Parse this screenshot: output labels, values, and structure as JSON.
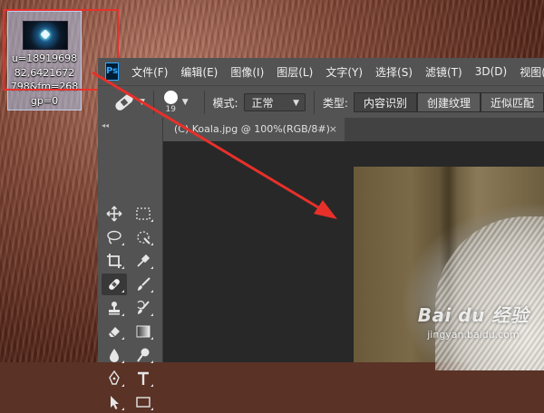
{
  "desktop": {
    "file_icon": {
      "label_lines": [
        "u=18919698",
        "82,6421672",
        "798&fm=268",
        "gp=0"
      ]
    }
  },
  "photoshop": {
    "logo": "Ps",
    "menu": [
      "文件(F)",
      "编辑(E)",
      "图像(I)",
      "图层(L)",
      "文字(Y)",
      "选择(S)",
      "滤镜(T)",
      "3D(D)",
      "视图("
    ],
    "options": {
      "brush_size": "19",
      "mode_label": "模式:",
      "mode_value": "正常",
      "type_label": "类型:",
      "type_options": [
        "内容识别",
        "创建纹理",
        "近似匹配"
      ],
      "type_selected": "内容识别"
    },
    "document_tab": {
      "title": "(C) Koala.jpg @ 100%(RGB/8#)",
      "close": "×"
    },
    "toolbox": {
      "collapse": "◂◂",
      "tools": [
        "move-tool",
        "marquee-tool",
        "lasso-tool",
        "quick-selection-tool",
        "crop-tool",
        "eyedropper-tool",
        "spot-healing-brush-tool",
        "brush-tool",
        "clone-stamp-tool",
        "history-brush-tool",
        "eraser-tool",
        "gradient-tool",
        "blur-tool",
        "dodge-tool",
        "pen-tool",
        "type-tool",
        "path-selection-tool",
        "rectangle-tool"
      ]
    }
  },
  "annotation": {
    "color": "#e8302a"
  },
  "watermark": {
    "brand": "Bai du 经验",
    "url": "jingyan.baidu.com"
  }
}
